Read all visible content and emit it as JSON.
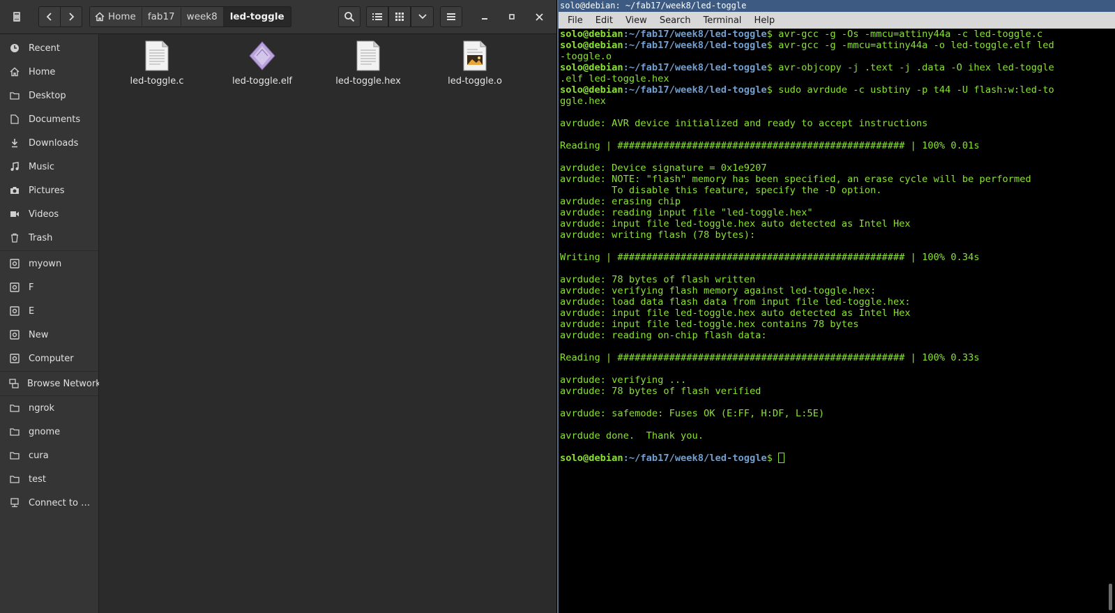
{
  "file_manager": {
    "path": [
      "Home",
      "fab17",
      "week8",
      "led-toggle"
    ],
    "sidebar": [
      {
        "label": "Recent",
        "icon": "clock-icon"
      },
      {
        "label": "Home",
        "icon": "home-icon"
      },
      {
        "label": "Desktop",
        "icon": "folder-icon"
      },
      {
        "label": "Documents",
        "icon": "document-icon"
      },
      {
        "label": "Downloads",
        "icon": "download-icon"
      },
      {
        "label": "Music",
        "icon": "music-icon"
      },
      {
        "label": "Pictures",
        "icon": "camera-icon"
      },
      {
        "label": "Videos",
        "icon": "video-icon"
      },
      {
        "label": "Trash",
        "icon": "trash-icon"
      },
      {
        "label": "myown",
        "icon": "drive-icon"
      },
      {
        "label": "F",
        "icon": "drive-icon"
      },
      {
        "label": "E",
        "icon": "drive-icon"
      },
      {
        "label": "New",
        "icon": "drive-icon"
      },
      {
        "label": "Computer",
        "icon": "drive-icon"
      },
      {
        "label": "Browse Network",
        "icon": "network-icon"
      },
      {
        "label": "ngrok",
        "icon": "folder-icon"
      },
      {
        "label": "gnome",
        "icon": "folder-icon"
      },
      {
        "label": "cura",
        "icon": "folder-icon"
      },
      {
        "label": "test",
        "icon": "folder-icon"
      },
      {
        "label": "Connect to Server",
        "icon": "server-icon"
      }
    ],
    "files": [
      {
        "name": "led-toggle.c",
        "icon": "text-file-icon"
      },
      {
        "name": "led-toggle.elf",
        "icon": "binary-file-icon"
      },
      {
        "name": "led-toggle.hex",
        "icon": "text-file-icon"
      },
      {
        "name": "led-toggle.o",
        "icon": "image-file-icon"
      }
    ]
  },
  "terminal": {
    "title": "solo@debian: ~/fab17/week8/led-toggle",
    "menu": [
      "File",
      "Edit",
      "View",
      "Search",
      "Terminal",
      "Help"
    ],
    "prompt_user": "solo@debian",
    "prompt_path": ":~/fab17/week8/led-toggle",
    "lines": [
      {
        "kind": "prompt",
        "text": "$ avr-gcc -g -Os -mmcu=attiny44a -c led-toggle.c"
      },
      {
        "kind": "prompt",
        "text": "$ avr-gcc -g -mmcu=attiny44a -o led-toggle.elf led"
      },
      {
        "kind": "out",
        "text": "-toggle.o"
      },
      {
        "kind": "prompt",
        "text": "$ avr-objcopy -j .text -j .data -O ihex led-toggle"
      },
      {
        "kind": "out",
        "text": ".elf led-toggle.hex"
      },
      {
        "kind": "prompt",
        "text": "$ sudo avrdude -c usbtiny -p t44 -U flash:w:led-to"
      },
      {
        "kind": "out",
        "text": "ggle.hex"
      },
      {
        "kind": "out",
        "text": ""
      },
      {
        "kind": "out",
        "text": "avrdude: AVR device initialized and ready to accept instructions"
      },
      {
        "kind": "out",
        "text": ""
      },
      {
        "kind": "out",
        "text": "Reading | ################################################## | 100% 0.01s"
      },
      {
        "kind": "out",
        "text": ""
      },
      {
        "kind": "out",
        "text": "avrdude: Device signature = 0x1e9207"
      },
      {
        "kind": "out",
        "text": "avrdude: NOTE: \"flash\" memory has been specified, an erase cycle will be performed"
      },
      {
        "kind": "out",
        "text": "         To disable this feature, specify the -D option."
      },
      {
        "kind": "out",
        "text": "avrdude: erasing chip"
      },
      {
        "kind": "out",
        "text": "avrdude: reading input file \"led-toggle.hex\""
      },
      {
        "kind": "out",
        "text": "avrdude: input file led-toggle.hex auto detected as Intel Hex"
      },
      {
        "kind": "out",
        "text": "avrdude: writing flash (78 bytes):"
      },
      {
        "kind": "out",
        "text": ""
      },
      {
        "kind": "out",
        "text": "Writing | ################################################## | 100% 0.34s"
      },
      {
        "kind": "out",
        "text": ""
      },
      {
        "kind": "out",
        "text": "avrdude: 78 bytes of flash written"
      },
      {
        "kind": "out",
        "text": "avrdude: verifying flash memory against led-toggle.hex:"
      },
      {
        "kind": "out",
        "text": "avrdude: load data flash data from input file led-toggle.hex:"
      },
      {
        "kind": "out",
        "text": "avrdude: input file led-toggle.hex auto detected as Intel Hex"
      },
      {
        "kind": "out",
        "text": "avrdude: input file led-toggle.hex contains 78 bytes"
      },
      {
        "kind": "out",
        "text": "avrdude: reading on-chip flash data:"
      },
      {
        "kind": "out",
        "text": ""
      },
      {
        "kind": "out",
        "text": "Reading | ################################################## | 100% 0.33s"
      },
      {
        "kind": "out",
        "text": ""
      },
      {
        "kind": "out",
        "text": "avrdude: verifying ..."
      },
      {
        "kind": "out",
        "text": "avrdude: 78 bytes of flash verified"
      },
      {
        "kind": "out",
        "text": ""
      },
      {
        "kind": "out",
        "text": "avrdude: safemode: Fuses OK (E:FF, H:DF, L:5E)"
      },
      {
        "kind": "out",
        "text": ""
      },
      {
        "kind": "out",
        "text": "avrdude done.  Thank you."
      },
      {
        "kind": "out",
        "text": ""
      },
      {
        "kind": "prompt_cursor",
        "text": "$ "
      }
    ]
  }
}
